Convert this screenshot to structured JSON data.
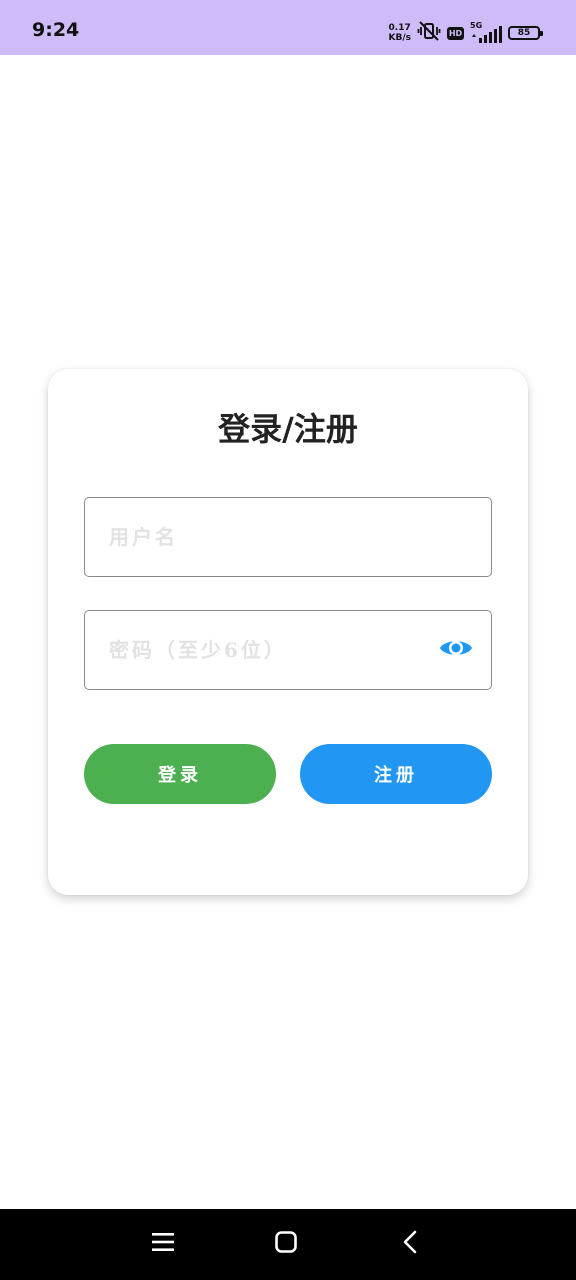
{
  "status_bar": {
    "time": "9:24",
    "net_speed_value": "0.17",
    "net_speed_unit": "KB/s",
    "hd_label": "HD",
    "network_gen": "5G",
    "battery_level": "85",
    "background_color": "#cdbcf7"
  },
  "card": {
    "title": "登录/注册",
    "username": {
      "value": "",
      "placeholder": "用户名"
    },
    "password": {
      "value": "",
      "placeholder": "密码（至少6位）",
      "toggle_icon": "eye-icon"
    },
    "login_button_label": "登录",
    "register_button_label": "注册",
    "colors": {
      "login_button": "#4caf50",
      "register_button": "#2196f3",
      "eye_icon": "#2196f3"
    }
  },
  "nav_bar": {
    "icons": [
      "menu-icon",
      "home-icon",
      "back-icon"
    ]
  }
}
